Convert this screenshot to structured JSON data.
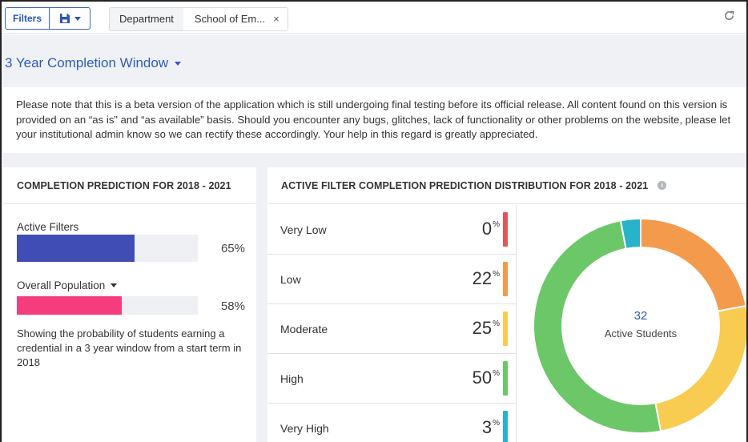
{
  "toolbar": {
    "filters_label": "Filters",
    "save_icon": "floppy-disk-icon",
    "chip_key": "Department",
    "chip_value": "School of Em...",
    "chip_close": "×",
    "refresh_icon": "refresh-icon"
  },
  "window": {
    "title": "3 Year Completion Window"
  },
  "notice": {
    "text": "Please note that this is a beta version of the application which is still undergoing final testing before its official release. All content found on this version is provided on an “as is” and “as available” basis. Should you encounter any bugs, glitches, lack of functionality or other problems on the website, please let your institutional admin know so we can rectify these accordingly. Your help in this regard is greatly appreciated."
  },
  "prediction": {
    "title": "COMPLETION PREDICTION FOR 2018 - 2021",
    "active_label": "Active Filters",
    "active_pct": "65%",
    "active_value": 0.65,
    "active_color": "#3f4db4",
    "population_label": "Overall Population",
    "population_pct": "58%",
    "population_value": 0.58,
    "population_color": "#f53d7d",
    "description": "Showing the probability of students earning a credential in a 3 year window from a start term in 2018"
  },
  "distribution": {
    "title": "ACTIVE FILTER COMPLETION PREDICTION DISTRIBUTION FOR 2018 - 2021",
    "info_icon": "info-icon",
    "rows": [
      {
        "label": "Very Low",
        "value": "0",
        "unit": "%",
        "color": "#e0575a"
      },
      {
        "label": "Low",
        "value": "22",
        "unit": "%",
        "color": "#f39a4d"
      },
      {
        "label": "Moderate",
        "value": "25",
        "unit": "%",
        "color": "#f8cc50"
      },
      {
        "label": "High",
        "value": "50",
        "unit": "%",
        "color": "#6cc768"
      },
      {
        "label": "Very High",
        "value": "3",
        "unit": "%",
        "color": "#27b3c9"
      }
    ],
    "donut_count": "32",
    "donut_caption": "Active Students"
  },
  "chart_data": {
    "type": "pie",
    "categories": [
      "Very Low",
      "Low",
      "Moderate",
      "High",
      "Very High"
    ],
    "values": [
      0,
      22,
      25,
      50,
      3
    ],
    "colors": [
      "#e0575a",
      "#f39a4d",
      "#f8cc50",
      "#6cc768",
      "#27b3c9"
    ]
  }
}
